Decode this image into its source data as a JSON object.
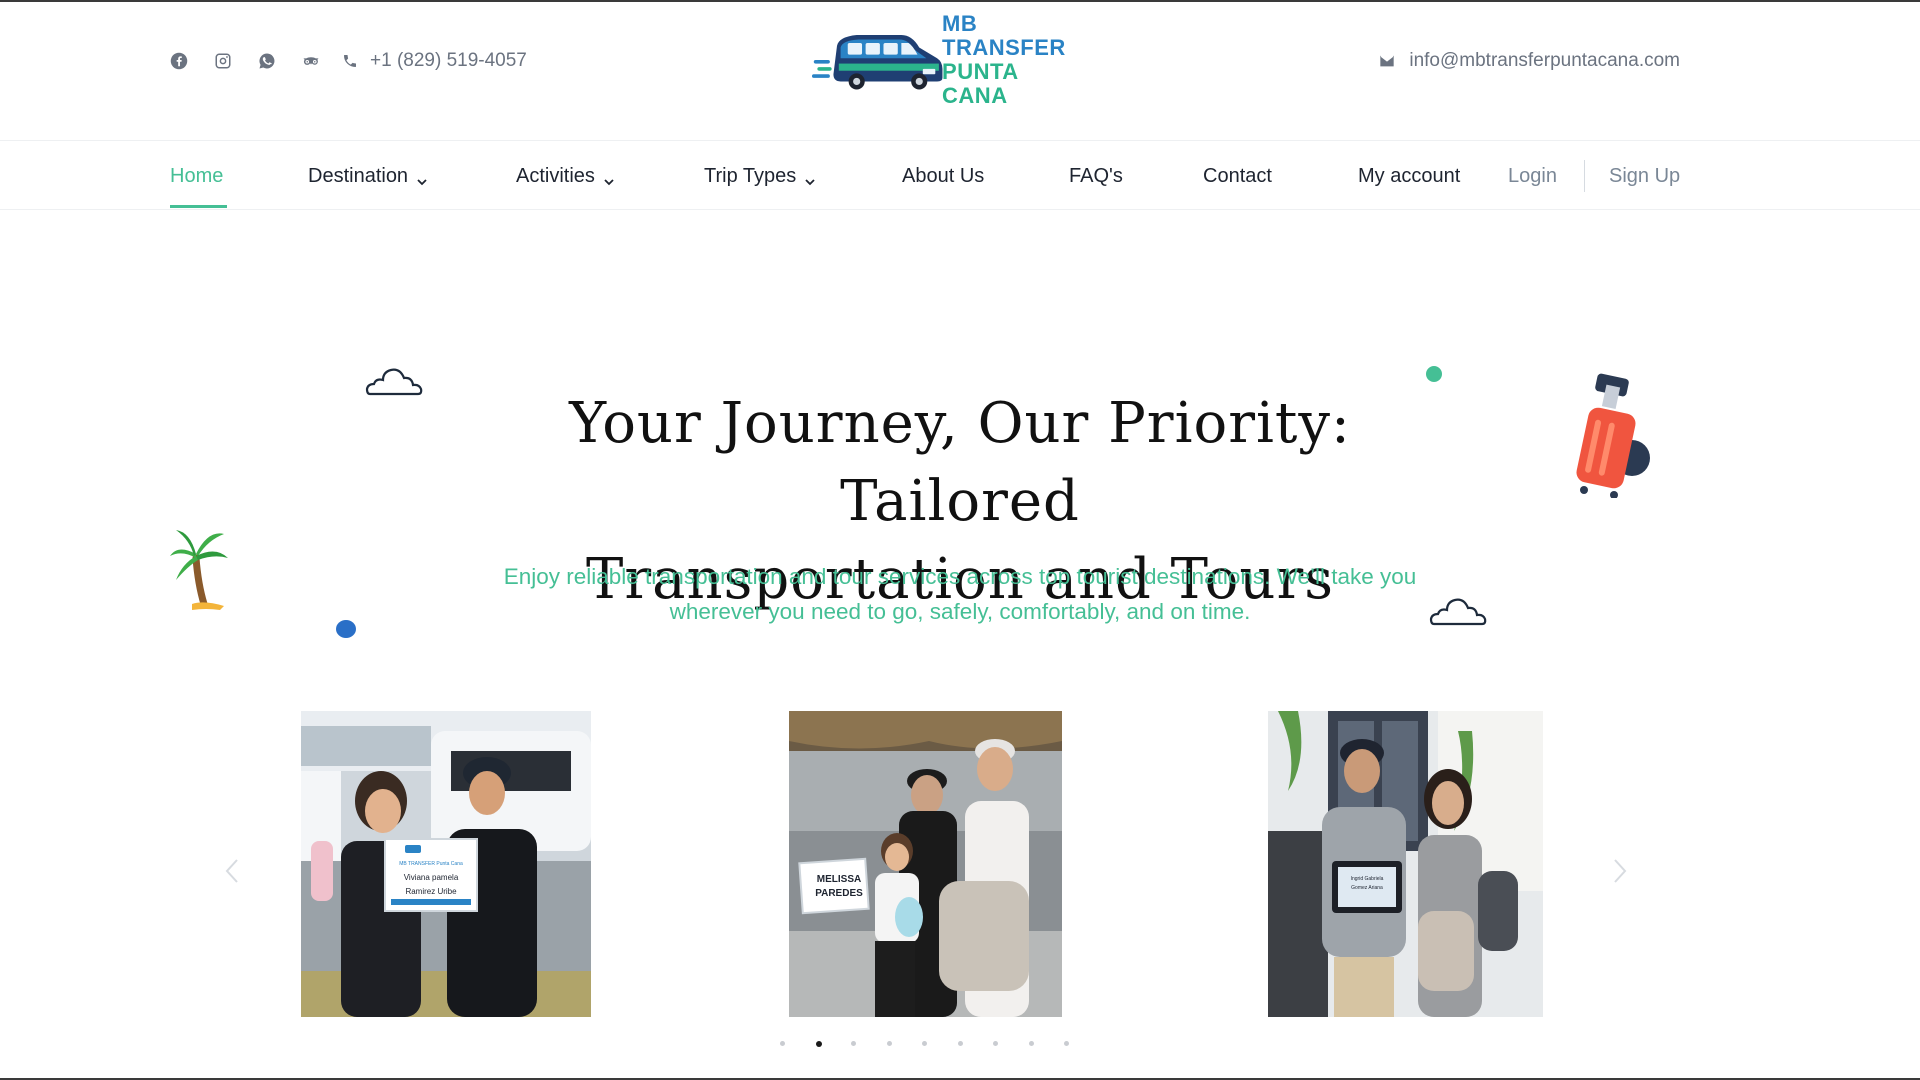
{
  "header": {
    "social_icons": [
      "facebook-icon",
      "instagram-icon",
      "whatsapp-icon",
      "tripadvisor-icon"
    ],
    "phone": "+1 (829) 519-4057",
    "email": "info@mbtransferpuntacana.com",
    "logo": {
      "line1": "MB TRANSFER",
      "line2": "PUNTA CANA"
    }
  },
  "nav": {
    "items": [
      {
        "label": "Home",
        "active": true
      },
      {
        "label": "Destination",
        "dropdown": true
      },
      {
        "label": "Activities",
        "dropdown": true
      },
      {
        "label": "Trip Types",
        "dropdown": true
      },
      {
        "label": "About Us"
      },
      {
        "label": "FAQ's"
      },
      {
        "label": "Contact"
      },
      {
        "label": "My account"
      }
    ],
    "login": "Login",
    "signup": "Sign Up"
  },
  "hero": {
    "title_line1": "Your Journey, Our Priority: Tailored",
    "title_line2": "Transportation and Tours",
    "subtitle_line1": "Enjoy reliable transportation and tour services across top tourist destinations. We’ll take you",
    "subtitle_line2": "wherever you need to go, safely, comfortably, and on time."
  },
  "carousel": {
    "slides": [
      {
        "sign_line1": "Viviana pamela",
        "sign_line2": "Ramirez Uribe",
        "sign_header": "MB TRANSFER Punta Cana"
      },
      {
        "sign_line1": "MELISSA",
        "sign_line2": "PAREDES"
      },
      {
        "sign_line1": "Ingrid Gabriela",
        "sign_line2": "Gomez Ariana"
      }
    ],
    "dot_count": 9,
    "active_dot": 1
  },
  "colors": {
    "accent": "#45bf95",
    "logo_blue": "#2a83c5",
    "logo_green": "#2bb48c",
    "text_dark": "#1e2430",
    "muted": "#6b7380",
    "suitcase": "#f0553f"
  }
}
